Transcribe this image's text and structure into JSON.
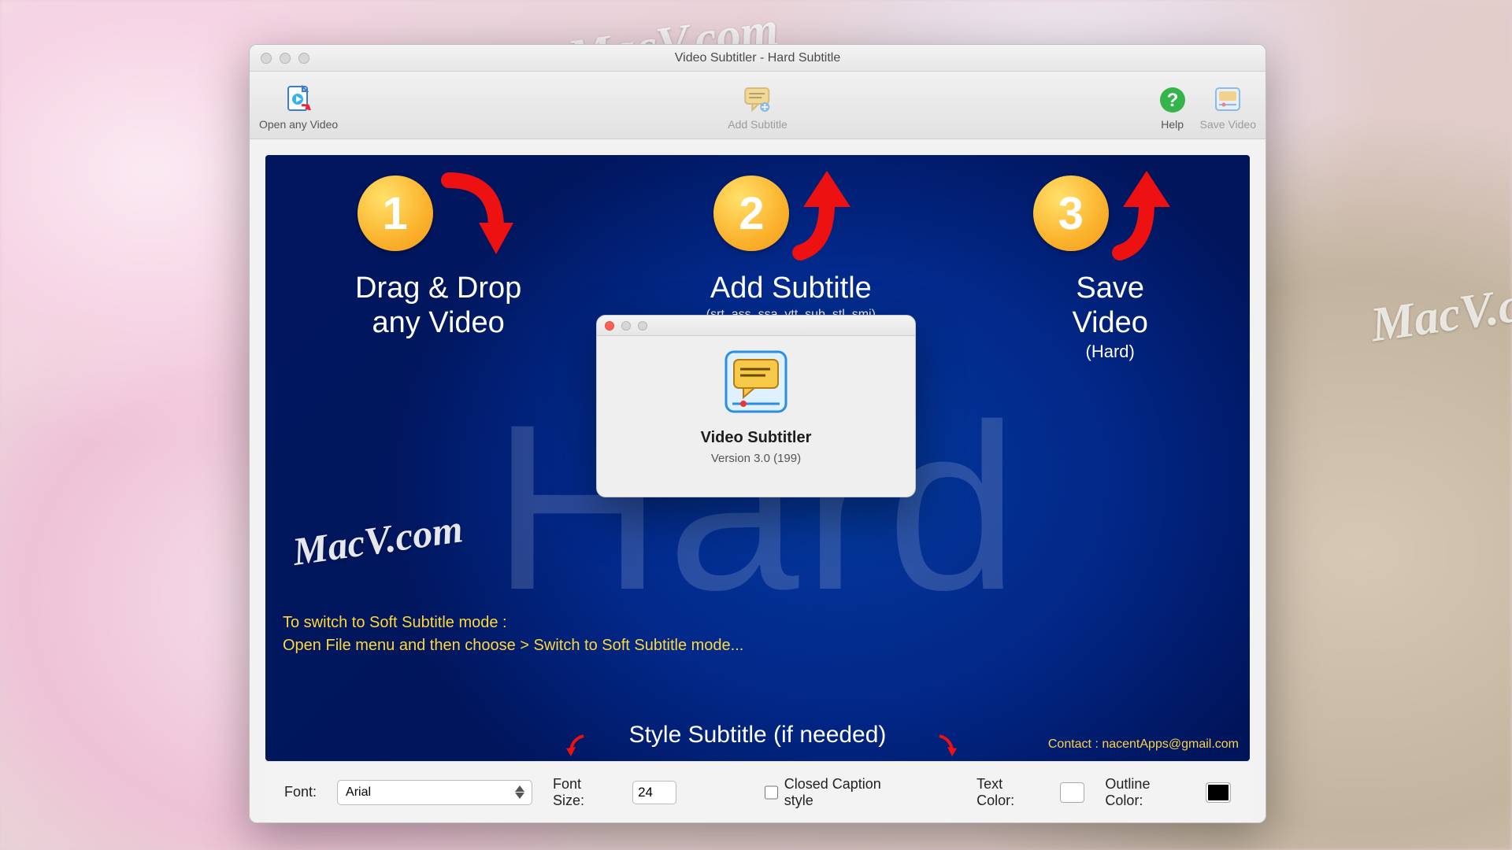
{
  "window": {
    "title": "Video Subtitler - Hard Subtitle"
  },
  "toolbar": {
    "open_label": "Open any Video",
    "add_label": "Add Subtitle",
    "help_label": "Help",
    "save_label": "Save Video"
  },
  "steps": {
    "one": {
      "num": "1",
      "title": "Drag & Drop\nany Video"
    },
    "two": {
      "num": "2",
      "title": "Add Subtitle",
      "note": "(srt, ass, ssa, vtt, sub, stl, smi)"
    },
    "three": {
      "num": "3",
      "title": "Save\nVideo",
      "sub": "(Hard)"
    }
  },
  "big_bg_word": "Hard",
  "hint": {
    "line1": "To switch to Soft Subtitle mode :",
    "line2": "Open File menu and then choose > Switch to Soft Subtitle mode..."
  },
  "style_label": "Style Subtitle (if needed)",
  "contact": "Contact : nacentApps@gmail.com",
  "bottom": {
    "font_label": "Font:",
    "font_value": "Arial",
    "size_label": "Font Size:",
    "size_value": "24",
    "cc_label": "Closed Caption style",
    "cc_checked": false,
    "text_color_label": "Text Color:",
    "text_color_value": "#ffffff",
    "outline_color_label": "Outline Color:",
    "outline_color_value": "#000000"
  },
  "about": {
    "app_name": "Video Subtitler",
    "version": "Version 3.0 (199)"
  },
  "watermark": "MacV.com"
}
